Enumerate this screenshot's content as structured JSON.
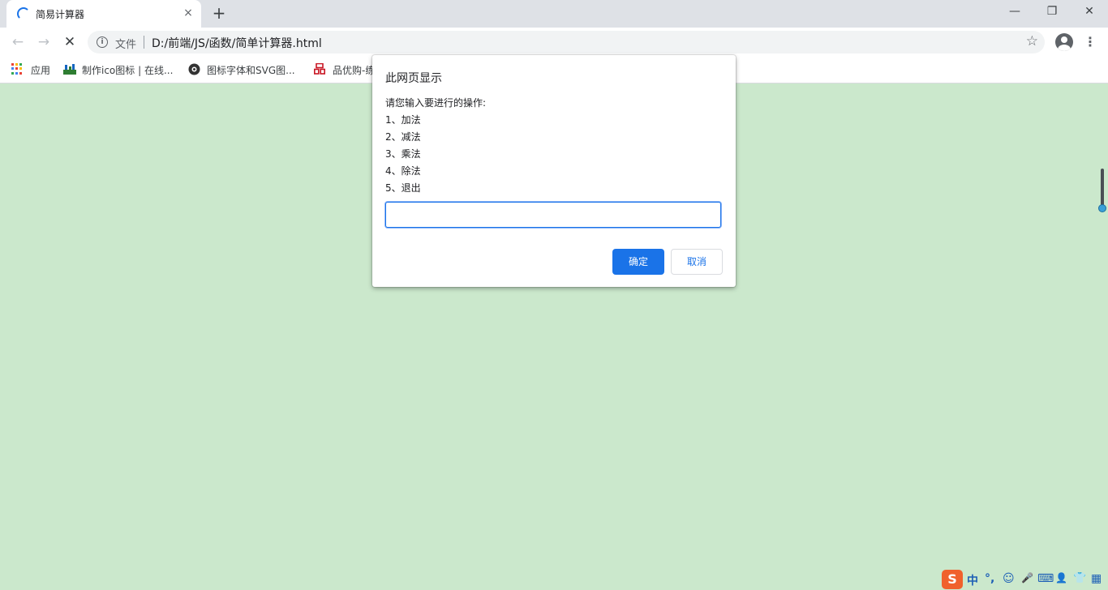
{
  "browser": {
    "tab": {
      "title": "简易计算器",
      "close_icon": "×"
    },
    "new_tab_icon": "+",
    "window_controls": {
      "minimize": "—",
      "restore": "❐",
      "close": "✕"
    },
    "nav": {
      "back": "←",
      "forward": "→",
      "stop": "✕"
    },
    "omnibox": {
      "info_icon": "i",
      "chip": "文件",
      "url": "D:/前端/JS/函数/简单计算器.html",
      "star_icon": "☆"
    },
    "menu_icon": "⋮"
  },
  "bookmarks": [
    {
      "label": "应用",
      "icon": "apps-grid-icon"
    },
    {
      "label": "制作ico图标 | 在线...",
      "icon": "bitbug-icon"
    },
    {
      "label": "图标字体和SVG图...",
      "icon": "iconfont-icon"
    },
    {
      "label": "品优购-练",
      "icon": "shop-icon"
    }
  ],
  "dialog": {
    "title": "此网页显示",
    "message_lines": [
      "请您输入要进行的操作:",
      "1、加法",
      "2、减法",
      "3、乘法",
      "4、除法",
      "5、退出"
    ],
    "input_value": "",
    "ok_label": "确定",
    "cancel_label": "取消"
  },
  "ime": {
    "logo": "S",
    "mode": "中",
    "punct": "°,",
    "emoji": "☺",
    "mic": "🎤",
    "keyboard": "⌨",
    "user": "👤",
    "skin": "👕",
    "grid": "▦"
  },
  "colors": {
    "page_background": "#cbe8cc",
    "accent": "#1a73e8"
  }
}
